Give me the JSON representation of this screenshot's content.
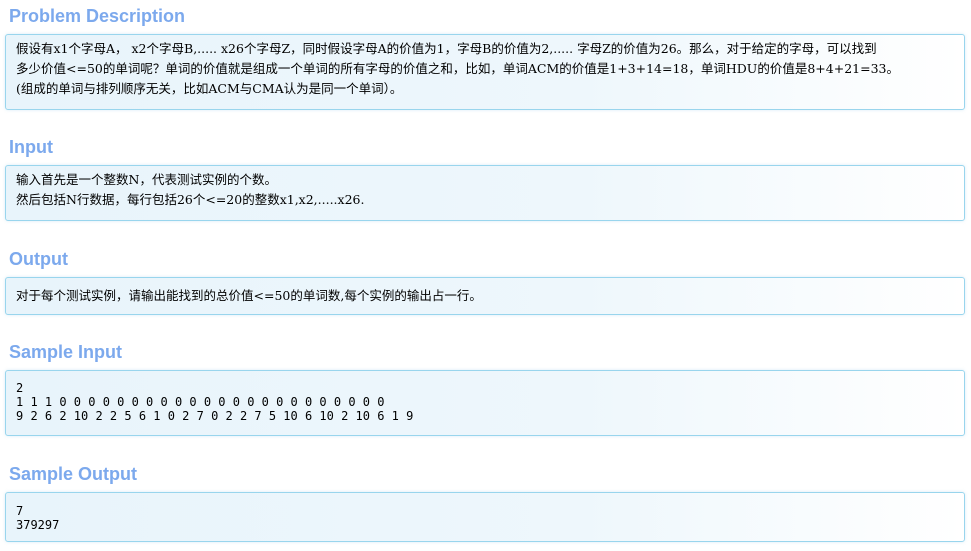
{
  "problem_description": {
    "title": "Problem Description",
    "lines": [
      "假设有x1个字母A， x2个字母B,..... x26个字母Z，同时假设字母A的价值为1，字母B的价值为2,..... 字母Z的价值为26。那么，对于给定的字母，可以找到",
      "多少价值<=50的单词呢？单词的价值就是组成一个单词的所有字母的价值之和，比如，单词ACM的价值是1+3+14=18，单词HDU的价值是8+4+21=33。",
      "(组成的单词与排列顺序无关，比如ACM与CMA认为是同一个单词）。"
    ]
  },
  "input": {
    "title": "Input",
    "lines": [
      "输入首先是一个整数N，代表测试实例的个数。",
      "然后包括N行数据，每行包括26个<=20的整数x1,x2,.....x26."
    ]
  },
  "output": {
    "title": "Output",
    "lines": [
      "对于每个测试实例，请输出能找到的总价值<=50的单词数,每个实例的输出占一行。"
    ]
  },
  "sample_input": {
    "title": "Sample Input",
    "lines": [
      "2",
      "1 1 1 0 0 0 0 0 0 0 0 0 0 0 0 0 0 0 0 0 0 0 0 0 0 0",
      "9 2 6 2 10 2 2 5 6 1 0 2 7 0 2 2 7 5 10 6 10 2 10 6 1 9"
    ]
  },
  "sample_output": {
    "title": "Sample Output",
    "lines": [
      "7",
      "379297"
    ]
  }
}
